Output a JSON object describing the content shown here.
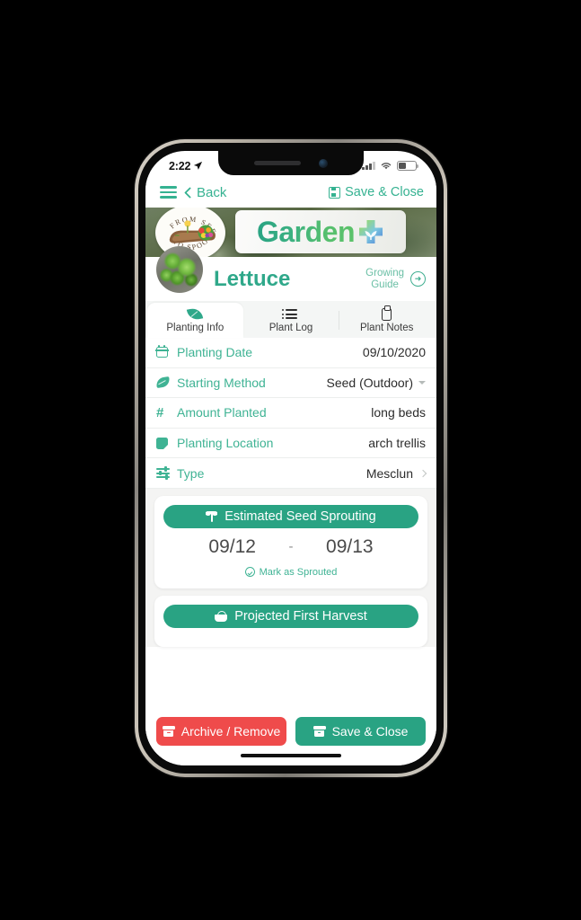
{
  "status_bar": {
    "time": "2:22",
    "location_icon": "location-arrow-icon",
    "signal_icon": "cellular-signal-icon",
    "wifi_icon": "wifi-icon",
    "battery_icon": "battery-icon"
  },
  "navbar": {
    "menu_icon": "hamburger-menu-icon",
    "back_label": "Back",
    "save_close_label": "Save & Close",
    "save_icon": "floppy-disk-icon"
  },
  "hero": {
    "badge_top_text": "FROM SEED",
    "badge_bottom_text": "TO SPOON",
    "app_name": "Garden",
    "app_mark_icon": "garden-plus-cross-icon"
  },
  "plant_header": {
    "thumb_icon": "lettuce-photo-thumbnail",
    "name": "Lettuce",
    "growing_guide_line1": "Growing",
    "growing_guide_line2": "Guide",
    "growing_guide_arrow_icon": "arrow-right-circle-icon"
  },
  "tabs": [
    {
      "label": "Planting Info",
      "icon": "leaf-icon",
      "active": true
    },
    {
      "label": "Plant Log",
      "icon": "list-icon",
      "active": false
    },
    {
      "label": "Plant Notes",
      "icon": "clipboard-icon",
      "active": false
    }
  ],
  "form_rows": [
    {
      "label": "Planting Date",
      "value": "09/10/2020",
      "icon": "calendar-icon",
      "affordance": "none"
    },
    {
      "label": "Starting Method",
      "value": "Seed (Outdoor)",
      "icon": "sprout-leaf-icon",
      "affordance": "caret-down"
    },
    {
      "label": "Amount Planted",
      "value": "long beds",
      "icon": "hash-icon",
      "affordance": "none"
    },
    {
      "label": "Planting Location",
      "value": "arch trellis",
      "icon": "note-icon",
      "affordance": "none"
    },
    {
      "label": "Type",
      "value": "Mesclun",
      "icon": "sliders-icon",
      "affordance": "chevron-right"
    }
  ],
  "cards": [
    {
      "title": "Estimated Seed Sprouting",
      "title_icon": "sprout-icon",
      "date_start": "09/12",
      "date_separator": "-",
      "date_end": "09/13",
      "action_label": "Mark as Sprouted",
      "action_icon": "check-circle-icon"
    },
    {
      "title": "Projected First Harvest",
      "title_icon": "harvest-basket-icon"
    }
  ],
  "action_bar": {
    "archive_label": "Archive / Remove",
    "archive_icon": "archive-box-icon",
    "archive_color": "#ef4b4b",
    "save_label": "Save & Close",
    "save_icon": "archive-box-icon",
    "save_color": "#29a383"
  },
  "theme": {
    "accent_teal": "#29a383",
    "accent_light_teal": "#3fb394",
    "danger_red": "#ef4b4b",
    "page_bg": "#f4f4f3"
  }
}
